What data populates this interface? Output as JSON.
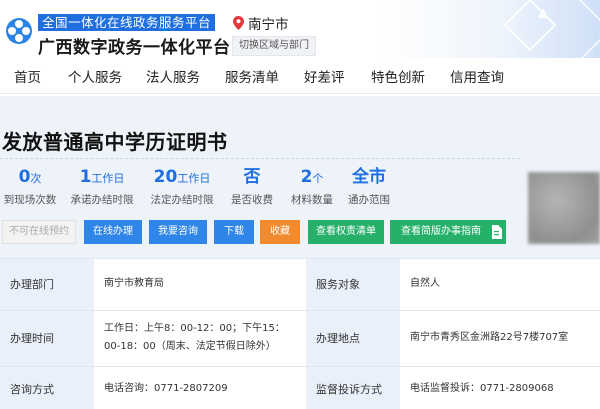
{
  "header": {
    "banner_text": "全国一体化在线政务服务平台",
    "brand_name": "广西数字政务一体化平台",
    "location": "南宁市",
    "switch_label": "切换区域与部门",
    "brand_color": "#1f6fe0",
    "icons": {
      "logo": "platform-logo-icon",
      "location": "map-pin-icon"
    }
  },
  "nav": {
    "items": [
      "首页",
      "个人服务",
      "法人服务",
      "服务清单",
      "好差评",
      "特色创新",
      "信用查询"
    ]
  },
  "service": {
    "title": "发放普通高中学历证明书",
    "stats": [
      {
        "value": "0",
        "unit": "次",
        "label": "到现场次数"
      },
      {
        "value": "1",
        "unit": "工作日",
        "label": "承诺办结时限"
      },
      {
        "value": "20",
        "unit": "工作日",
        "label": "法定办结时限"
      },
      {
        "value": "否",
        "unit": "",
        "label": "是否收费"
      },
      {
        "value": "2",
        "unit": "个",
        "label": "材料数量"
      },
      {
        "value": "全市",
        "unit": "",
        "label": "通办范围"
      }
    ]
  },
  "actions": {
    "appointment": "不可在线预约",
    "online": "在线办理",
    "consult": "我要咨询",
    "download": "下载",
    "favorite": "收藏",
    "power_list": "查看权责清单",
    "guide": "查看简版办事指南"
  },
  "info": {
    "rows": [
      {
        "l1": "办理部门",
        "v1": "南宁市教育局",
        "l2": "服务对象",
        "v2": "自然人"
      },
      {
        "l1": "办理时间",
        "v1": "工作日：上午8：00-12：00；下午15：00-18：00（周末、法定节假日除外）",
        "l2": "办理地点",
        "v2": "南宁市青秀区金洲路22号7楼707室"
      },
      {
        "l1": "咨询方式",
        "v1": "电话咨询：0771-2807209",
        "l2": "监督投诉方式",
        "v2": "电话监督投诉：0771-2809068"
      }
    ]
  }
}
